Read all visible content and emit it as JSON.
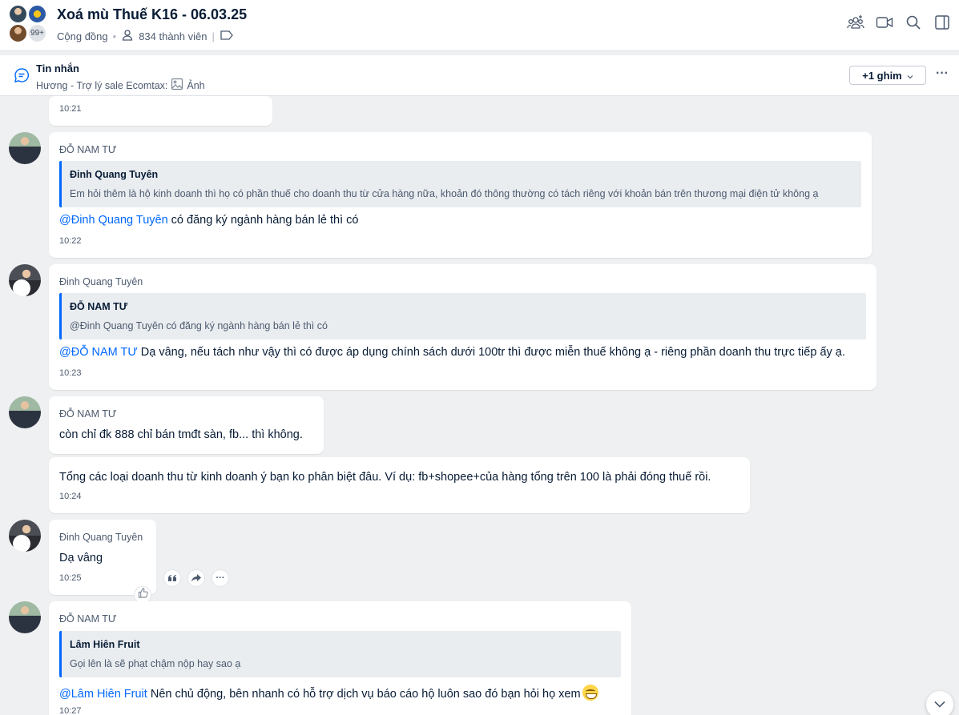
{
  "header": {
    "title": "Xoá mù Thuế K16 - 06.03.25",
    "community_label": "Cộng đồng",
    "members": "834 thành viên",
    "avatar_overflow": "99+",
    "icons": [
      "add-members-icon",
      "video-call-icon",
      "search-icon",
      "sidebar-toggle-icon"
    ]
  },
  "pinned": {
    "title": "Tin nhắn",
    "sender": "Hương - Trợ lý sale Ecomtax:",
    "attachment": "Ảnh",
    "pin_button": "+1 ghim",
    "more": "···"
  },
  "messages": [
    {
      "time": "10:21"
    },
    {
      "sender": "ĐỖ NAM TƯ",
      "quote": {
        "name": "Đinh Quang Tuyên",
        "text": "Em hỏi thêm là hộ kinh doanh thì họ có phần thuế cho doanh thu từ cửa hàng nữa, khoản đó thông thường có tách riêng với khoản bán trên thương mại điện tử không ạ"
      },
      "mention": "@Đinh Quang Tuyên",
      "text": " có đăng ký ngành hàng bán lẻ thì có",
      "time": "10:22"
    },
    {
      "sender": "Đinh Quang Tuyên",
      "quote": {
        "name": "ĐỖ NAM TƯ",
        "text": "@Đinh Quang Tuyên có đăng ký ngành hàng bán lẻ thì có"
      },
      "mention": "@ĐỖ NAM TƯ",
      "text": " Dạ vâng, nếu tách như vậy thì có được áp dụng chính sách dưới 100tr thì được miễn thuế không ạ - riêng phần doanh thu trực tiếp ấy ạ.",
      "time": "10:23"
    },
    {
      "sender": "ĐỖ NAM TƯ",
      "text": "còn chỉ đk 888 chỉ bán tmđt sàn, fb... thì không."
    },
    {
      "text": "Tổng các loại doanh thu từ kinh doanh ý bạn ko phân biệt đâu. Ví dụ: fb+shopee+của hàng tổng trên 100 là phải đóng thuế rồi.",
      "time": "10:24"
    },
    {
      "sender": "Đinh Quang Tuyên",
      "text": "Dạ vâng",
      "time": "10:25"
    },
    {
      "sender": "ĐỖ NAM TƯ",
      "quote": {
        "name": "Lâm Hiên Fruit",
        "text": "Gọi lên là sẽ phạt chậm nộp hay sao ạ"
      },
      "mention": "@Lâm Hiên Fruit",
      "text": " Nên chủ động, bên nhanh có hỗ trợ dịch vụ báo cáo hộ luôn sao đó bạn hỏi họ xem",
      "time": "10:27"
    }
  ],
  "message_actions": [
    "quote-icon",
    "forward-icon",
    "more-icon"
  ],
  "colors": {
    "accent": "#0068ff",
    "background": "#eef0f1",
    "text": "#081c36",
    "muted": "#4c5a6e"
  }
}
